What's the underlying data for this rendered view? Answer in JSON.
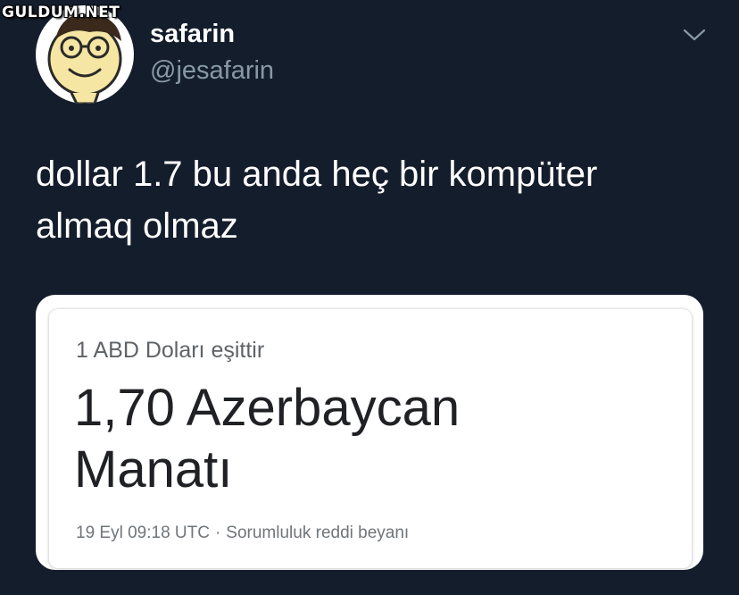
{
  "watermark": "GULDUM.NET",
  "user": {
    "display_name": "safarin",
    "handle": "@jesafarin"
  },
  "menu_icon": "chevron-down-icon",
  "tweet": {
    "text": "dollar 1.7 bu anda heç bir kompüter\nalmaq olmaz"
  },
  "converter": {
    "label": "1 ABD Doları eşittir",
    "result": "1,70 Azerbaycan\nManatı",
    "timestamp": "19 Eyl 09:18 UTC",
    "separator": "·",
    "disclaimer": "Sorumluluk reddi beyanı"
  },
  "colors": {
    "background": "#141d2b",
    "secondary_text": "#8899a6",
    "card": "#ffffff"
  }
}
